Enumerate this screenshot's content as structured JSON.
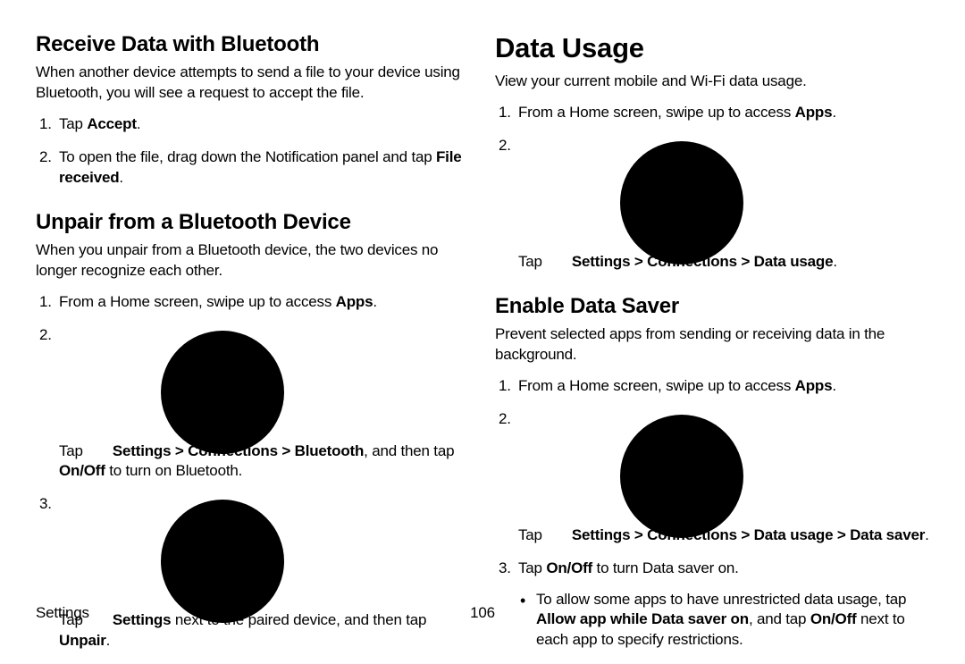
{
  "left": {
    "h_receive": "Receive Data with Bluetooth",
    "receive_intro": "When another device attempts to send a file to your device using Bluetooth, you will see a request to accept the file.",
    "receive_steps": [
      {
        "pre": "Tap ",
        "bold": "Accept",
        "post": "."
      },
      {
        "pre": "To open the file, drag down the Notification panel and tap ",
        "bold": "File received",
        "post": "."
      }
    ],
    "h_unpair": "Unpair from a Bluetooth Device",
    "unpair_intro": "When you unpair from a Bluetooth device, the two devices no longer recognize each other.",
    "unpair_step1": {
      "pre": "From a Home screen, swipe up to access ",
      "bold": "Apps",
      "post": "."
    },
    "unpair_step2": {
      "pre": "Tap ",
      "bold1": "Settings > Connections > Bluetooth",
      "mid": ", and then tap ",
      "bold2": "On/Off",
      "post": " to turn on Bluetooth."
    },
    "unpair_step3": {
      "pre": "Tap ",
      "bold1": "Settings",
      "mid": " next to the paired device, and then tap ",
      "bold2": "Unpair",
      "post": "."
    }
  },
  "right": {
    "h_data_usage": "Data Usage",
    "du_intro": "View your current mobile and Wi-Fi data usage.",
    "du_step1": {
      "pre": "From a Home screen, swipe up to access ",
      "bold": "Apps",
      "post": "."
    },
    "du_step2": {
      "pre": "Tap ",
      "bold": "Settings > Connections > Data usage",
      "post": "."
    },
    "h_saver": "Enable Data Saver",
    "saver_intro": "Prevent selected apps from sending or receiving data in the background.",
    "saver_step1": {
      "pre": "From a Home screen, swipe up to access ",
      "bold": "Apps",
      "post": "."
    },
    "saver_step2": {
      "pre": "Tap ",
      "bold": "Settings > Connections > Data usage > Data saver",
      "post": "."
    },
    "saver_step3": {
      "pre": "Tap ",
      "bold": "On/Off",
      "post": " to turn Data saver on."
    },
    "saver_bullet": {
      "pre": "To allow some apps to have unrestricted data usage, tap ",
      "bold1": "Allow app while Data saver on",
      "mid": ", and tap ",
      "bold2": "On/Off",
      "post": " next to each app to specify restrictions."
    }
  },
  "footer": {
    "section": "Settings",
    "page": "106"
  }
}
